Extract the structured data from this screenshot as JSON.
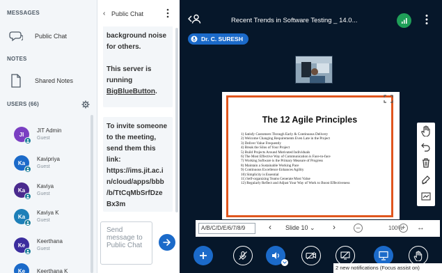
{
  "sidebar": {
    "messages_title": "MESSAGES",
    "public_chat_label": "Public Chat",
    "notes_title": "NOTES",
    "shared_notes_label": "Shared Notes",
    "users_title": "USERS (66)",
    "users": [
      {
        "initials": "JI",
        "name": "JIT Admin",
        "role": "Guest",
        "color": "#7a3fc2"
      },
      {
        "initials": "Ka",
        "name": "Kavipriya",
        "role": "Guest",
        "color": "#1b6ac9"
      },
      {
        "initials": "Ka",
        "name": "Kaviya",
        "role": "Guest",
        "color": "#4a2a8e"
      },
      {
        "initials": "Ka",
        "name": "Kaviya K",
        "role": "Guest",
        "color": "#1d7fb8"
      },
      {
        "initials": "Ke",
        "name": "Keerthana",
        "role": "Guest",
        "color": "#3b2d9e"
      },
      {
        "initials": "Ke",
        "name": "Keerthana K",
        "role": "Guest",
        "color": "#1b6ac9"
      }
    ]
  },
  "chat": {
    "title": "Public Chat",
    "msg1_line1": "background noise",
    "msg1_line2": "for others.",
    "msg1_line3": "This server is",
    "msg1_line4": "running",
    "msg1_link": "BigBlueButton",
    "msg1_end": ".",
    "msg2": [
      "To invite someone",
      "to the meeting,",
      "send them this",
      "link:",
      "https://ims.jit.ac.i",
      "n/cloud/apps/bbb",
      "/b/TtCqMbSrfDze",
      "Bx3m"
    ],
    "input_placeholder": "Send message to Public Chat"
  },
  "main": {
    "meeting_title": "Recent Trends in Software Testing _ 14.0...",
    "presenter": "Dr. C. SURESH",
    "slide_title": "The 12 Agile Principles",
    "slide_items": [
      "1) Satisfy Customers Through Early & Continuous Delivery",
      "2) Welcome Changing Requirements Even Late in the Project",
      "3) Deliver Value Frequently",
      "4) Break the Silos of Your Project",
      "5) Build Projects Around Motivated Individuals",
      "6) The Most Effective Way of Communication is Face-to-face",
      "7) Working Software is the Primary Measure of Progress",
      "8) Maintain a Sustainable Working Pace",
      "9) Continuous Excellence Enhances Agility",
      "10) Simplicity is Essential",
      "11) Self-organizing Teams Generate Most Value",
      "12) Regularly Reflect and Adjust Your Way of Work to Boost Effectiveness"
    ],
    "slide_select": "A/B/C/D/E/6/7/8/9",
    "slide_label": "Slide 10",
    "zoom": "100%",
    "toast": "2 new notifications (Focus assist on)"
  },
  "colors": {
    "accent": "#1b6ac9",
    "stats": "#1f9f58",
    "slide_border": "#e0561e",
    "main_bg": "#06172a"
  }
}
